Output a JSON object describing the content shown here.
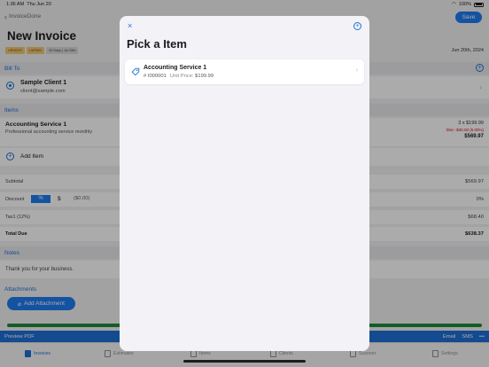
{
  "status": {
    "time": "1:36 AM",
    "date": "Thu Jun 20",
    "battery": "100%"
  },
  "nav": {
    "back_label": "InvoiceDone",
    "save_label": "Save",
    "title": "New Invoice"
  },
  "badges": [
    "URGENT",
    "UNPAID",
    "30 Days | Jul 20th"
  ],
  "due_date": "Jun 20th, 2024",
  "bill_to": {
    "header": "Bill To",
    "client_name": "Sample Client 1",
    "client_email": "client@sample.com"
  },
  "items": {
    "header": "Items",
    "line": {
      "name": "Accounting Service 1",
      "description": "Professional accounting service monthly",
      "qty_price": "3 x $199.99",
      "discount": "Disc -$30.00 (5.00%)",
      "total": "$569.97"
    },
    "add_label": "Add Item"
  },
  "summary": {
    "subtotal_label": "Subtotal",
    "subtotal_value": "$569.97",
    "discount_label": "Discount",
    "pct_label": "%",
    "dollar_label": "$",
    "discount_amount": "($0.00)",
    "discount_value": "0%",
    "tax_label": "Tax1 (12%)",
    "tax_value": "$68.40",
    "total_label": "Total Due",
    "total_value": "$638.37"
  },
  "notes": {
    "header": "Notes",
    "text": "Thank you for your business."
  },
  "attachments": {
    "header": "Attachments",
    "button_label": "Add Attachment"
  },
  "bottom_bar": {
    "preview_label": "Preview PDF",
    "email_label": "Email",
    "sms_label": "SMS",
    "more_label": "•••"
  },
  "tabs": [
    {
      "label": "Invoices",
      "active": true
    },
    {
      "label": "Estimates",
      "active": false
    },
    {
      "label": "Items",
      "active": false
    },
    {
      "label": "Clients",
      "active": false
    },
    {
      "label": "Scanner",
      "active": false
    },
    {
      "label": "Settings",
      "active": false
    }
  ],
  "modal": {
    "close_glyph": "×",
    "add_glyph": "+",
    "title": "Pick a Item",
    "items": [
      {
        "name": "Accounting Service 1",
        "sku": "# I000001",
        "price_label": "Unit Price:",
        "price": "$199.99"
      }
    ]
  },
  "colors": {
    "accent": "#1f7bf2",
    "discount_red": "#d0021b",
    "strip_green": "#1e8a3c"
  }
}
